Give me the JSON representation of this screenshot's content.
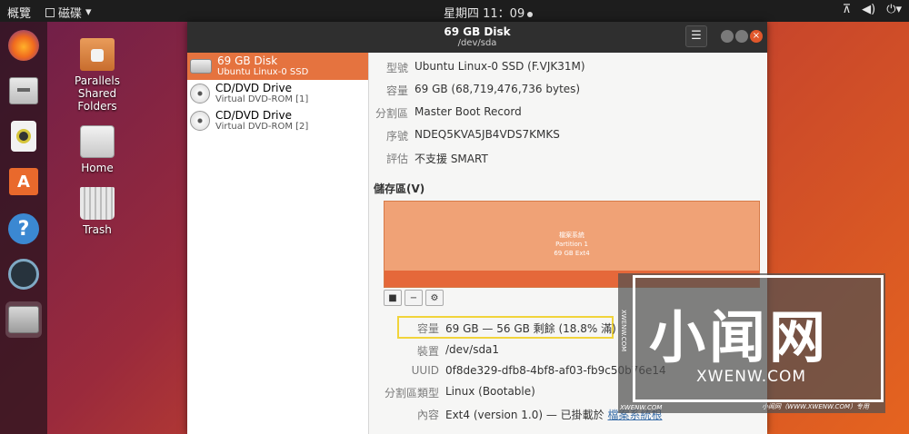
{
  "topbar": {
    "activities": "概覽",
    "app_menu": "磁碟",
    "clock": "星期四 11：09"
  },
  "desktop": {
    "icons": [
      {
        "label": "Parallels Shared Folders"
      },
      {
        "label": "Home"
      },
      {
        "label": "Trash"
      }
    ]
  },
  "window": {
    "title": "69 GB Disk",
    "subtitle": "/dev/sda",
    "menu_icon": "☰"
  },
  "drives": [
    {
      "name": "69 GB Disk",
      "sub": "Ubuntu Linux-0 SSD",
      "selected": true
    },
    {
      "name": "CD/DVD Drive",
      "sub": "Virtual DVD-ROM [1]",
      "selected": false
    },
    {
      "name": "CD/DVD Drive",
      "sub": "Virtual DVD-ROM [2]",
      "selected": false
    }
  ],
  "disk_props": {
    "model_label": "型號",
    "model_value": "Ubuntu Linux-0 SSD (F.VJK31M)",
    "size_label": "容量",
    "size_value": "69 GB (68,719,476,736 bytes)",
    "partitioning_label": "分割區",
    "partitioning_value": "Master Boot Record",
    "serial_label": "序號",
    "serial_value": "NDEQ5KVA5JB4VDS7KMKS",
    "assessment_label": "評估",
    "assessment_value": "不支援 SMART"
  },
  "volumes": {
    "title": "儲存區(V)",
    "map_line1": "檔案系統",
    "map_line2": "Partition 1",
    "map_line3": "69 GB Ext4"
  },
  "volume_props": {
    "size_label": "容量",
    "size_value": "69 GB — 56 GB 剩餘 (18.8% 滿)",
    "device_label": "裝置",
    "device_value": "/dev/sda1",
    "uuid_label": "UUID",
    "uuid_value": "0f8de329-dfb8-4bf8-af03-fb9c50b76e14",
    "ptype_label": "分割區類型",
    "ptype_value": "Linux (Bootable)",
    "contents_label": "內容",
    "contents_value": "Ext4 (version 1.0) — 已掛載於 ",
    "contents_link": "檔案系統根"
  },
  "watermark": {
    "big": "小闻网",
    "url": "XWENW.COM",
    "vertical": "XWENW.COM",
    "foot": "小闻网（WWW.XWENW.COM）专用",
    "foot2": "XWENW.COM"
  }
}
